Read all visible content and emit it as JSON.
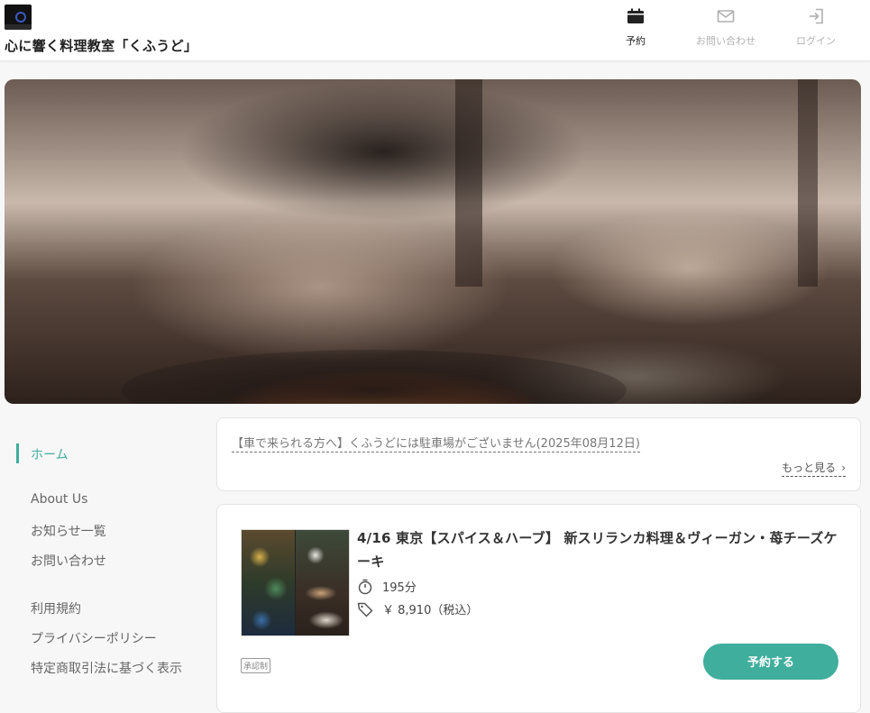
{
  "header": {
    "site_title": "心に響く料理教室「くふうど」",
    "nav": {
      "reserve_label": "予約",
      "contact_label": "お問い合わせ",
      "login_label": "ログイン"
    }
  },
  "sidebar": {
    "items": [
      {
        "label": "ホーム",
        "active": true
      },
      {
        "label": "About Us"
      },
      {
        "label": "お知らせ一覧"
      },
      {
        "label": "お問い合わせ"
      },
      {
        "label": "利用規約"
      },
      {
        "label": "プライバシーポリシー"
      },
      {
        "label": "特定商取引法に基づく表示"
      }
    ]
  },
  "notice": {
    "text": "【車で来られる方へ】くふうどには駐車場がございません(2025年08月12日)",
    "more_label": "もっと見る"
  },
  "course": {
    "title": "4/16 東京【スパイス＆ハーブ】 新スリランカ料理＆ヴィーガン・苺チーズケーキ",
    "duration": "195分",
    "price": "￥ 8,910（税込）",
    "badge": "承認制",
    "reserve_label": "予約する"
  },
  "colors": {
    "accent": "#3fae9c",
    "nav_inactive": "#b0b0b0"
  },
  "icons": {
    "logo": "kufudo-logo",
    "reserve": "calendar-icon",
    "contact": "envelope-icon",
    "login": "login-icon",
    "duration": "timer-icon",
    "price": "tag-icon",
    "more": "chevron-right-icon"
  }
}
